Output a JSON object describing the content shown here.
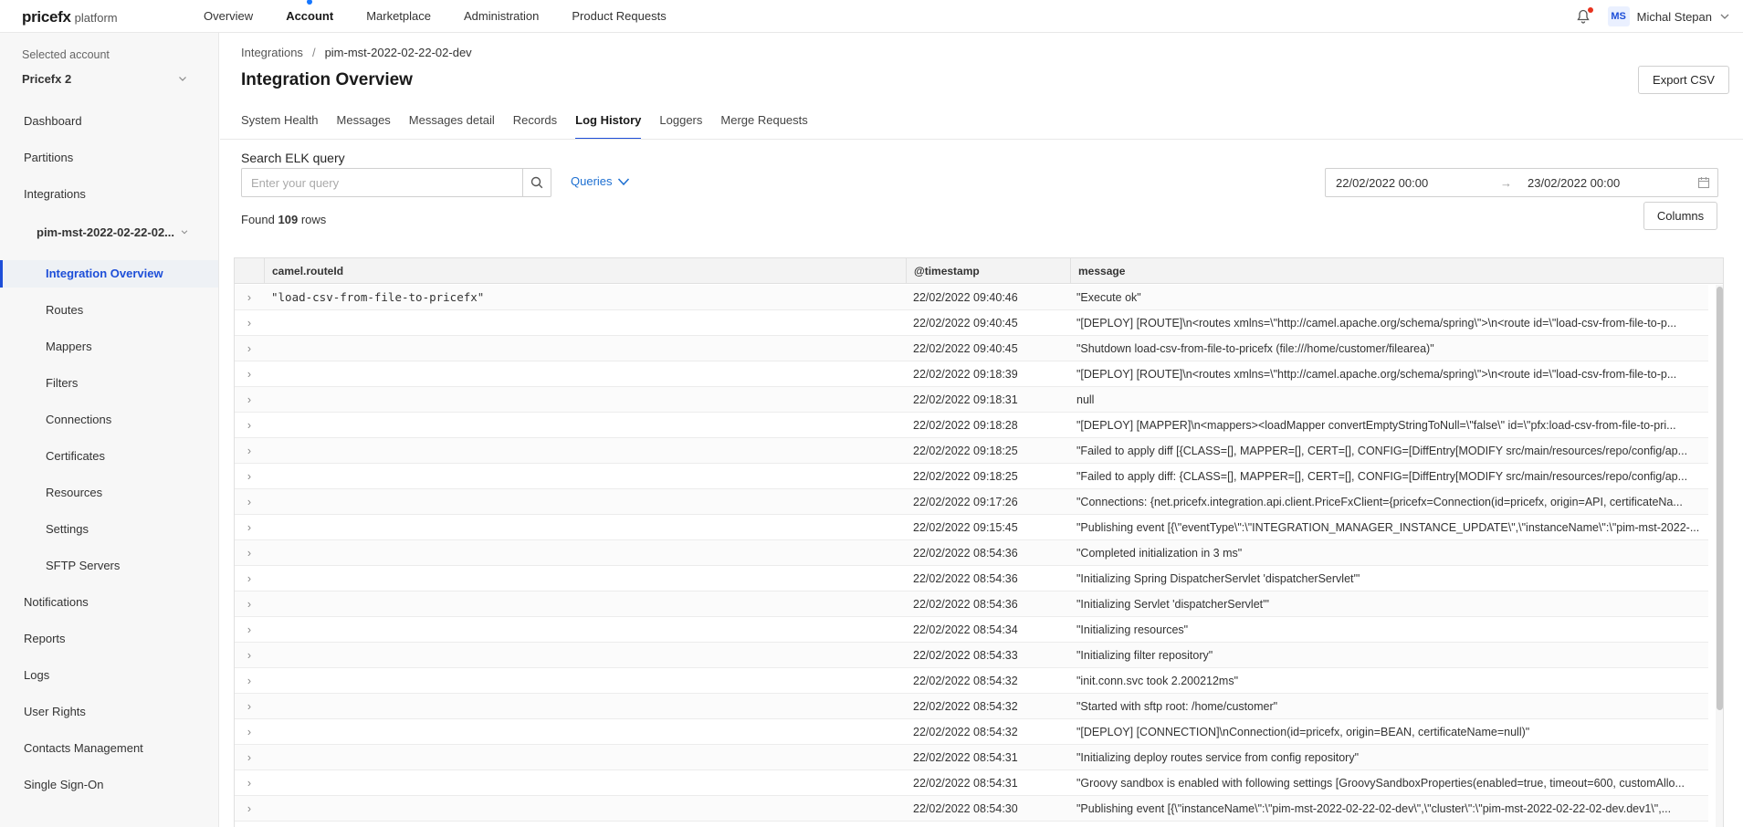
{
  "brand": {
    "logo_text": "pricefx",
    "platform_label": "platform"
  },
  "topnav": {
    "items": [
      "Overview",
      "Account",
      "Marketplace",
      "Administration",
      "Product Requests"
    ],
    "active": "Account"
  },
  "user": {
    "initials": "MS",
    "name": "Michal Stepan"
  },
  "sidebar": {
    "account_label": "Selected account",
    "account_value": "Pricefx 2",
    "items": [
      {
        "label": "Dashboard"
      },
      {
        "label": "Partitions"
      },
      {
        "label": "Integrations"
      },
      {
        "label": "pim-mst-2022-02-22-02..."
      },
      {
        "label": "Integration Overview"
      },
      {
        "label": "Routes"
      },
      {
        "label": "Mappers"
      },
      {
        "label": "Filters"
      },
      {
        "label": "Connections"
      },
      {
        "label": "Certificates"
      },
      {
        "label": "Resources"
      },
      {
        "label": "Settings"
      },
      {
        "label": "SFTP Servers"
      },
      {
        "label": "Notifications"
      },
      {
        "label": "Reports"
      },
      {
        "label": "Logs"
      },
      {
        "label": "User Rights"
      },
      {
        "label": "Contacts Management"
      },
      {
        "label": "Single Sign-On"
      }
    ]
  },
  "breadcrumb": {
    "root": "Integrations",
    "separator": "/",
    "current": "pim-mst-2022-02-22-02-dev"
  },
  "page": {
    "title": "Integration Overview",
    "export_label": "Export CSV"
  },
  "tabs": [
    "System Health",
    "Messages",
    "Messages detail",
    "Records",
    "Log History",
    "Loggers",
    "Merge Requests"
  ],
  "active_tab": "Log History",
  "search": {
    "label": "Search ELK query",
    "placeholder": "Enter your query",
    "queries_label": "Queries"
  },
  "daterange": {
    "from": "22/02/2022 00:00",
    "arrow": "→",
    "to": "23/02/2022 00:00"
  },
  "results": {
    "prefix": "Found",
    "count": "109",
    "suffix": "rows",
    "columns_label": "Columns"
  },
  "table": {
    "columns": [
      "camel.routeId",
      "@timestamp",
      "message"
    ],
    "rows": [
      {
        "route": "\"load-csv-from-file-to-pricefx\"",
        "ts": "22/02/2022 09:40:46",
        "msg": "\"Execute ok\""
      },
      {
        "route": "",
        "ts": "22/02/2022 09:40:45",
        "msg": "\"[DEPLOY] [ROUTE]\\n<routes xmlns=\\\"http://camel.apache.org/schema/spring\\\">\\n<route id=\\\"load-csv-from-file-to-p..."
      },
      {
        "route": "",
        "ts": "22/02/2022 09:40:45",
        "msg": "\"Shutdown load-csv-from-file-to-pricefx (file:///home/customer/filearea)\""
      },
      {
        "route": "",
        "ts": "22/02/2022 09:18:39",
        "msg": "\"[DEPLOY] [ROUTE]\\n<routes xmlns=\\\"http://camel.apache.org/schema/spring\\\">\\n<route id=\\\"load-csv-from-file-to-p..."
      },
      {
        "route": "",
        "ts": "22/02/2022 09:18:31",
        "msg": "null"
      },
      {
        "route": "",
        "ts": "22/02/2022 09:18:28",
        "msg": "\"[DEPLOY] [MAPPER]\\n<mappers><loadMapper convertEmptyStringToNull=\\\"false\\\" id=\\\"pfx:load-csv-from-file-to-pri..."
      },
      {
        "route": "",
        "ts": "22/02/2022 09:18:25",
        "msg": "\"Failed to apply diff [{CLASS=[], MAPPER=[], CERT=[], CONFIG=[DiffEntry[MODIFY src/main/resources/repo/config/ap..."
      },
      {
        "route": "",
        "ts": "22/02/2022 09:18:25",
        "msg": "\"Failed to apply diff: {CLASS=[], MAPPER=[], CERT=[], CONFIG=[DiffEntry[MODIFY src/main/resources/repo/config/ap..."
      },
      {
        "route": "",
        "ts": "22/02/2022 09:17:26",
        "msg": "\"Connections: {net.pricefx.integration.api.client.PriceFxClient={pricefx=Connection(id=pricefx, origin=API, certificateNa..."
      },
      {
        "route": "",
        "ts": "22/02/2022 09:15:45",
        "msg": "\"Publishing event [{\\\"eventType\\\":\\\"INTEGRATION_MANAGER_INSTANCE_UPDATE\\\",\\\"instanceName\\\":\\\"pim-mst-2022-..."
      },
      {
        "route": "",
        "ts": "22/02/2022 08:54:36",
        "msg": "\"Completed initialization in 3 ms\""
      },
      {
        "route": "",
        "ts": "22/02/2022 08:54:36",
        "msg": "\"Initializing Spring DispatcherServlet 'dispatcherServlet'\""
      },
      {
        "route": "",
        "ts": "22/02/2022 08:54:36",
        "msg": "\"Initializing Servlet 'dispatcherServlet'\""
      },
      {
        "route": "",
        "ts": "22/02/2022 08:54:34",
        "msg": "\"Initializing resources\""
      },
      {
        "route": "",
        "ts": "22/02/2022 08:54:33",
        "msg": "\"Initializing filter repository\""
      },
      {
        "route": "",
        "ts": "22/02/2022 08:54:32",
        "msg": "\"init.conn.svc took 2.200212ms\""
      },
      {
        "route": "",
        "ts": "22/02/2022 08:54:32",
        "msg": "\"Started with sftp root: /home/customer\""
      },
      {
        "route": "",
        "ts": "22/02/2022 08:54:32",
        "msg": "\"[DEPLOY] [CONNECTION]\\nConnection(id=pricefx, origin=BEAN, certificateName=null)\""
      },
      {
        "route": "",
        "ts": "22/02/2022 08:54:31",
        "msg": "\"Initializing deploy routes service from config repository\""
      },
      {
        "route": "",
        "ts": "22/02/2022 08:54:31",
        "msg": "\"Groovy sandbox is enabled with following settings [GroovySandboxProperties(enabled=true, timeout=600, customAllo..."
      },
      {
        "route": "",
        "ts": "22/02/2022 08:54:30",
        "msg": "\"Publishing event [{\\\"instanceName\\\":\\\"pim-mst-2022-02-22-02-dev\\\",\\\"cluster\\\":\\\"pim-mst-2022-02-22-02-dev.dev1\\\",..."
      }
    ]
  },
  "colors": {
    "accent": "#1d4ed8",
    "link": "#1d6fd1",
    "notification_dot": "#e8321e"
  }
}
